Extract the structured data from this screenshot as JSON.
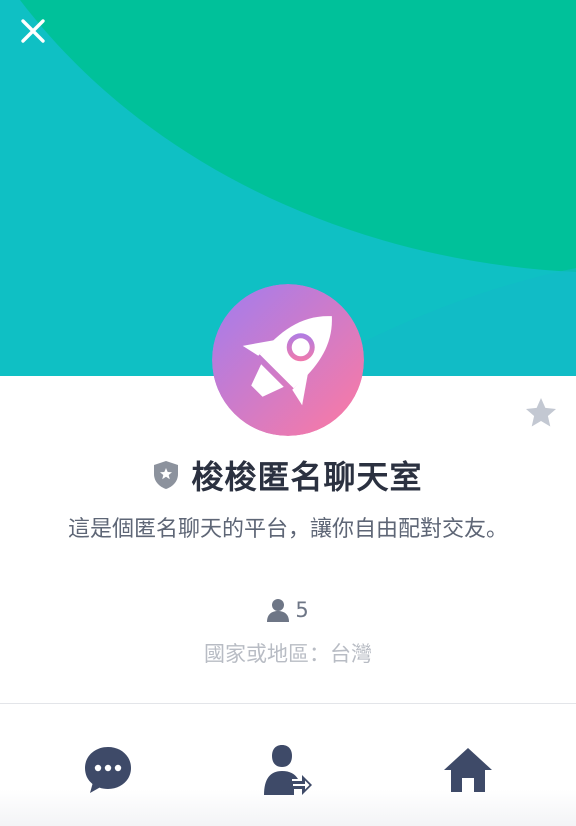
{
  "header": {
    "close_icon": "close-icon",
    "cover_colors": [
      "#0fc0c4",
      "#00c19a"
    ]
  },
  "room": {
    "avatar_icon": "rocket-icon",
    "avatar_gradient": [
      "#a07cf0",
      "#ff7aa0"
    ],
    "badge_icon": "shield-star-icon",
    "name": "梭梭匿名聊天室",
    "description": "這是個匿名聊天的平台，讓你自由配對交友。",
    "member_count": "5",
    "member_icon": "person-icon",
    "region": "國家或地區：台灣",
    "favorite_icon": "star-icon"
  },
  "bottom_bar": {
    "chat_icon": "chat-bubble-icon",
    "share_icon": "share-user-icon",
    "home_icon": "home-icon",
    "icon_color": "#3e4a68"
  }
}
